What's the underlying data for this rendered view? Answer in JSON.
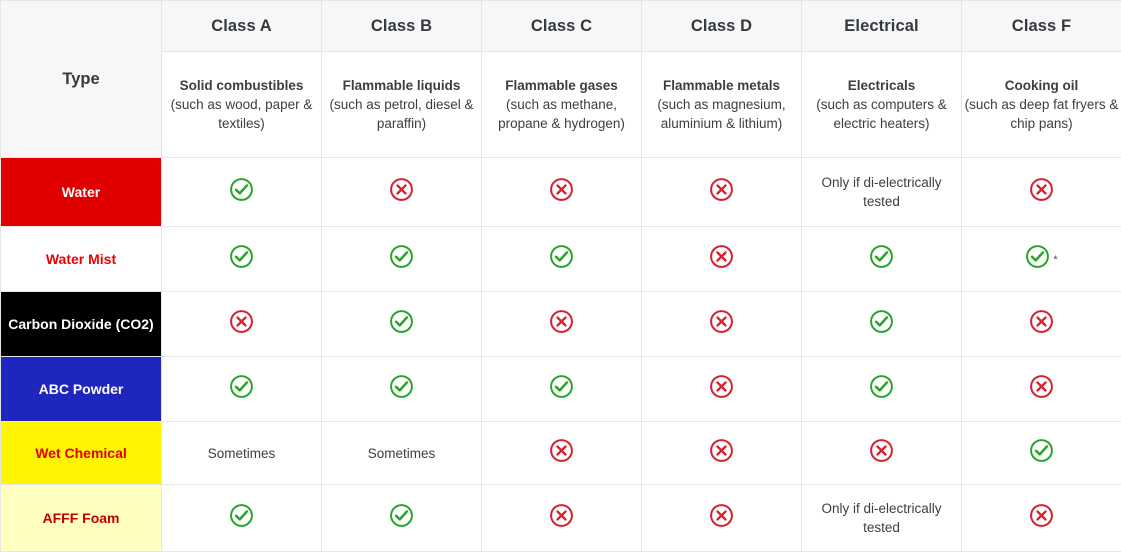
{
  "table": {
    "type_header": "Type",
    "columns": [
      {
        "class_label": "Class A",
        "desc_title": "Solid combustibles",
        "desc_sub": "(such as wood, paper & textiles)"
      },
      {
        "class_label": "Class B",
        "desc_title": "Flammable liquids",
        "desc_sub": "(such as petrol, diesel & paraffin)"
      },
      {
        "class_label": "Class C",
        "desc_title": "Flammable gases",
        "desc_sub": "(such as methane, propane & hydrogen)"
      },
      {
        "class_label": "Class D",
        "desc_title": "Flammable metals",
        "desc_sub": "(such as magnesium, aluminium & lithium)"
      },
      {
        "class_label": "Electrical",
        "desc_title": "Electricals",
        "desc_sub": "(such as computers & electric heaters)"
      },
      {
        "class_label": "Class F",
        "desc_title": "Cooking oil",
        "desc_sub": "(such as deep fat fryers & chip pans)"
      }
    ],
    "rows": [
      {
        "label": "Water",
        "bg": "#E00000",
        "fg": "#ffffff",
        "cells": [
          {
            "kind": "yes"
          },
          {
            "kind": "no"
          },
          {
            "kind": "no"
          },
          {
            "kind": "no"
          },
          {
            "kind": "text",
            "text": "Only if di-electrically tested"
          },
          {
            "kind": "no"
          }
        ]
      },
      {
        "label": "Water Mist",
        "bg": "#ffffff",
        "fg": "#EE0000",
        "cells": [
          {
            "kind": "yes"
          },
          {
            "kind": "yes"
          },
          {
            "kind": "yes"
          },
          {
            "kind": "no"
          },
          {
            "kind": "yes"
          },
          {
            "kind": "yes",
            "note": "*"
          }
        ]
      },
      {
        "label": "Carbon Dioxide (CO2)",
        "bg": "#000000",
        "fg": "#ffffff",
        "cells": [
          {
            "kind": "no"
          },
          {
            "kind": "yes"
          },
          {
            "kind": "no"
          },
          {
            "kind": "no"
          },
          {
            "kind": "yes"
          },
          {
            "kind": "no"
          }
        ]
      },
      {
        "label": "ABC Powder",
        "bg": "#1F26BE",
        "fg": "#ffffff",
        "cells": [
          {
            "kind": "yes"
          },
          {
            "kind": "yes"
          },
          {
            "kind": "yes"
          },
          {
            "kind": "no"
          },
          {
            "kind": "yes"
          },
          {
            "kind": "no"
          }
        ]
      },
      {
        "label": "Wet Chemical",
        "bg": "#FFF500",
        "fg": "#E00000",
        "cells": [
          {
            "kind": "text",
            "text": "Sometimes"
          },
          {
            "kind": "text",
            "text": "Sometimes"
          },
          {
            "kind": "no"
          },
          {
            "kind": "no"
          },
          {
            "kind": "no"
          },
          {
            "kind": "yes"
          }
        ]
      },
      {
        "label": "AFFF Foam",
        "bg": "#FFFFC2",
        "fg": "#C00000",
        "cells": [
          {
            "kind": "yes"
          },
          {
            "kind": "yes"
          },
          {
            "kind": "no"
          },
          {
            "kind": "no"
          },
          {
            "kind": "text",
            "text": "Only if di-electrically tested"
          },
          {
            "kind": "no"
          }
        ]
      }
    ]
  },
  "icons": {
    "yes_color": "#28a428",
    "no_color": "#D6202B",
    "yes_name": "check-circle-icon",
    "no_name": "cross-circle-icon"
  }
}
